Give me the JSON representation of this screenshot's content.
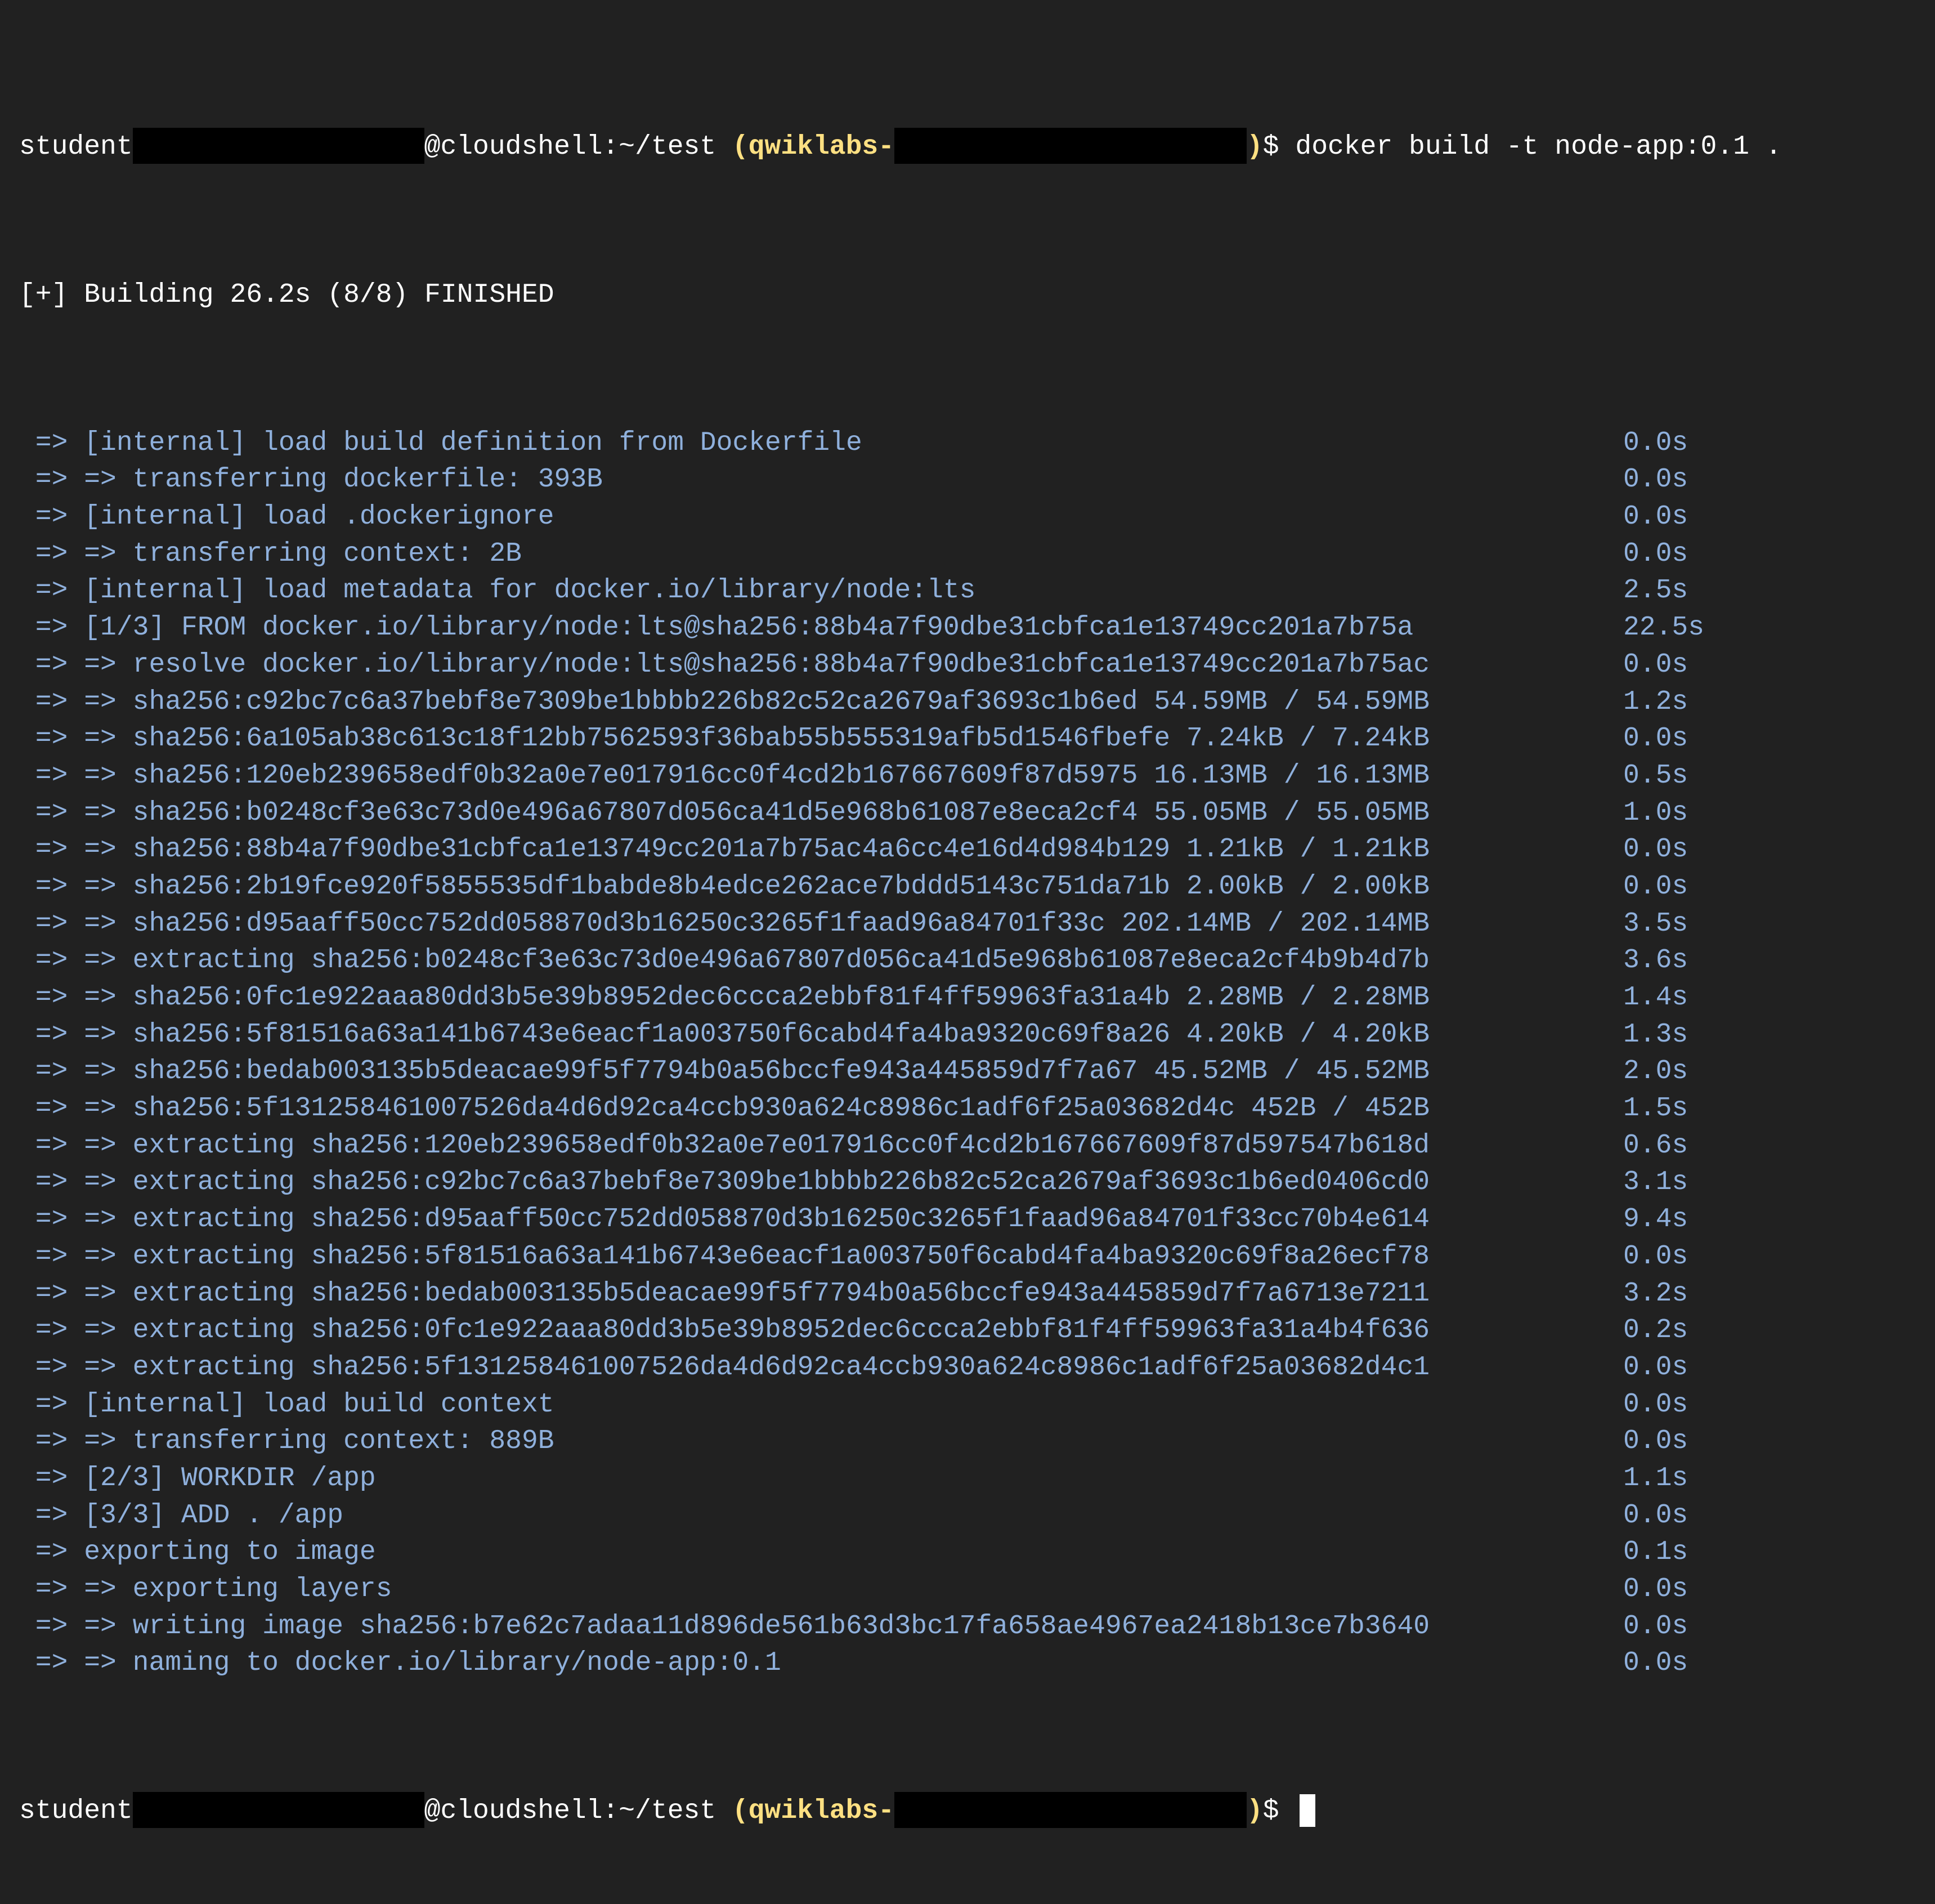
{
  "prompt": {
    "user": "student",
    "host_path": "@cloudshell:~/test ",
    "project_open": "(qwiklabs-",
    "project_close": ")",
    "dollar": "$ "
  },
  "command": "docker build -t node-app:0.1 .",
  "header": "[+] Building 26.2s (8/8) FINISHED",
  "steps": [
    {
      "text": " => [internal] load build definition from Dockerfile",
      "time": "0.0s"
    },
    {
      "text": " => => transferring dockerfile: 393B",
      "time": "0.0s"
    },
    {
      "text": " => [internal] load .dockerignore",
      "time": "0.0s"
    },
    {
      "text": " => => transferring context: 2B",
      "time": "0.0s"
    },
    {
      "text": " => [internal] load metadata for docker.io/library/node:lts",
      "time": "2.5s"
    },
    {
      "text": " => [1/3] FROM docker.io/library/node:lts@sha256:88b4a7f90dbe31cbfca1e13749cc201a7b75a",
      "time": "22.5s"
    },
    {
      "text": " => => resolve docker.io/library/node:lts@sha256:88b4a7f90dbe31cbfca1e13749cc201a7b75ac",
      "time": "0.0s"
    },
    {
      "text": " => => sha256:c92bc7c6a37bebf8e7309be1bbbb226b82c52ca2679af3693c1b6ed 54.59MB / 54.59MB",
      "time": "1.2s"
    },
    {
      "text": " => => sha256:6a105ab38c613c18f12bb7562593f36bab55b555319afb5d1546fbefe 7.24kB / 7.24kB",
      "time": "0.0s"
    },
    {
      "text": " => => sha256:120eb239658edf0b32a0e7e017916cc0f4cd2b167667609f87d5975 16.13MB / 16.13MB",
      "time": "0.5s"
    },
    {
      "text": " => => sha256:b0248cf3e63c73d0e496a67807d056ca41d5e968b61087e8eca2cf4 55.05MB / 55.05MB",
      "time": "1.0s"
    },
    {
      "text": " => => sha256:88b4a7f90dbe31cbfca1e13749cc201a7b75ac4a6cc4e16d4d984b129 1.21kB / 1.21kB",
      "time": "0.0s"
    },
    {
      "text": " => => sha256:2b19fce920f5855535df1babde8b4edce262ace7bddd5143c751da71b 2.00kB / 2.00kB",
      "time": "0.0s"
    },
    {
      "text": " => => sha256:d95aaff50cc752dd058870d3b16250c3265f1faad96a84701f33c 202.14MB / 202.14MB",
      "time": "3.5s"
    },
    {
      "text": " => => extracting sha256:b0248cf3e63c73d0e496a67807d056ca41d5e968b61087e8eca2cf4b9b4d7b",
      "time": "3.6s"
    },
    {
      "text": " => => sha256:0fc1e922aaa80dd3b5e39b8952dec6ccca2ebbf81f4ff59963fa31a4b 2.28MB / 2.28MB",
      "time": "1.4s"
    },
    {
      "text": " => => sha256:5f81516a63a141b6743e6eacf1a003750f6cabd4fa4ba9320c69f8a26 4.20kB / 4.20kB",
      "time": "1.3s"
    },
    {
      "text": " => => sha256:bedab003135b5deacae99f5f7794b0a56bccfe943a445859d7f7a67 45.52MB / 45.52MB",
      "time": "2.0s"
    },
    {
      "text": " => => sha256:5f131258461007526da4d6d92ca4ccb930a624c8986c1adf6f25a03682d4c 452B / 452B",
      "time": "1.5s"
    },
    {
      "text": " => => extracting sha256:120eb239658edf0b32a0e7e017916cc0f4cd2b167667609f87d597547b618d",
      "time": "0.6s"
    },
    {
      "text": " => => extracting sha256:c92bc7c6a37bebf8e7309be1bbbb226b82c52ca2679af3693c1b6ed0406cd0",
      "time": "3.1s"
    },
    {
      "text": " => => extracting sha256:d95aaff50cc752dd058870d3b16250c3265f1faad96a84701f33cc70b4e614",
      "time": "9.4s"
    },
    {
      "text": " => => extracting sha256:5f81516a63a141b6743e6eacf1a003750f6cabd4fa4ba9320c69f8a26ecf78",
      "time": "0.0s"
    },
    {
      "text": " => => extracting sha256:bedab003135b5deacae99f5f7794b0a56bccfe943a445859d7f7a6713e7211",
      "time": "3.2s"
    },
    {
      "text": " => => extracting sha256:0fc1e922aaa80dd3b5e39b8952dec6ccca2ebbf81f4ff59963fa31a4b4f636",
      "time": "0.2s"
    },
    {
      "text": " => => extracting sha256:5f131258461007526da4d6d92ca4ccb930a624c8986c1adf6f25a03682d4c1",
      "time": "0.0s"
    },
    {
      "text": " => [internal] load build context",
      "time": "0.0s"
    },
    {
      "text": " => => transferring context: 889B",
      "time": "0.0s"
    },
    {
      "text": " => [2/3] WORKDIR /app",
      "time": "1.1s"
    },
    {
      "text": " => [3/3] ADD . /app",
      "time": "0.0s"
    },
    {
      "text": " => exporting to image",
      "time": "0.1s"
    },
    {
      "text": " => => exporting layers",
      "time": "0.0s"
    },
    {
      "text": " => => writing image sha256:b7e62c7adaa11d896de561b63d3bc17fa658ae4967ea2418b13ce7b3640",
      "time": "0.0s"
    },
    {
      "text": " => => naming to docker.io/library/node-app:0.1",
      "time": "0.0s"
    }
  ],
  "colors": {
    "background": "#212121",
    "prompt_text": "#ffffff",
    "project": "#ffe082",
    "step_text": "#8fb0dc",
    "redaction": "#000000",
    "cursor": "#ffffff"
  }
}
